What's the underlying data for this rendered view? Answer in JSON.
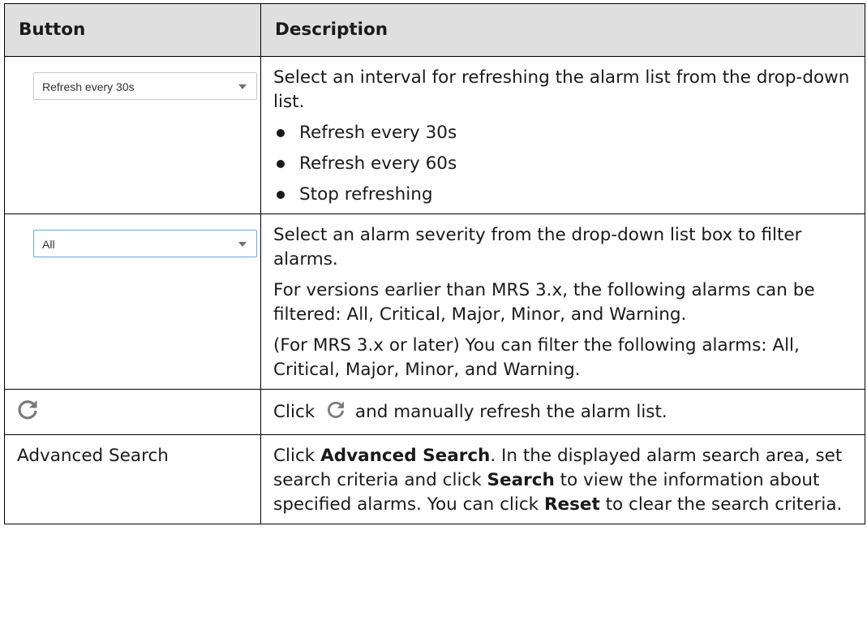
{
  "table": {
    "headers": {
      "button": "Button",
      "description": "Description"
    },
    "rows": {
      "refresh_interval": {
        "control": {
          "value": "Refresh every 30s",
          "icon": "chevron-down-icon"
        },
        "text": "Select an interval for refreshing the alarm list from the drop-down list.",
        "bullets": [
          "Refresh every 30s",
          "Refresh every 60s",
          "Stop refreshing"
        ]
      },
      "severity": {
        "control": {
          "value": "All",
          "icon": "chevron-down-icon"
        },
        "p1": "Select an alarm severity from the drop-down list box to filter alarms.",
        "p2": "For versions earlier than MRS 3.x, the following alarms can be filtered: All, Critical, Major, Minor, and Warning.",
        "p3": "(For MRS 3.x or later) You can filter the following alarms: All, Critical, Major, Minor, and Warning."
      },
      "refresh": {
        "icon": "refresh-icon",
        "text_before": "Click",
        "text_after": "and manually refresh the alarm list."
      },
      "advanced_search": {
        "button": "Advanced Search",
        "t1": "Click ",
        "b1": "Advanced Search",
        "t2": ". In the displayed alarm search area, set search criteria and click ",
        "b2": "Search",
        "t3": " to view the information about specified alarms. You can click ",
        "b3": "Reset",
        "t4": " to clear the search criteria."
      }
    }
  },
  "colors": {
    "header_bg": "#dfdfdf",
    "border": "#000000",
    "select_border_blue": "#6ea4e8",
    "icon_gray": "#7a7a7a"
  }
}
